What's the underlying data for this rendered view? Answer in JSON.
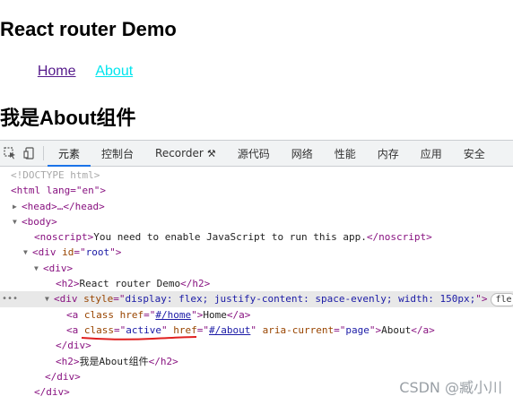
{
  "page": {
    "title": "React router Demo",
    "nav": {
      "home_label": "Home",
      "about_label": "About"
    },
    "component_title": "我是About组件"
  },
  "devtools": {
    "tabs": [
      {
        "label": "元素",
        "selected": true
      },
      {
        "label": "控制台"
      },
      {
        "label": "Recorder",
        "icon": "flask-icon"
      },
      {
        "label": "源代码"
      },
      {
        "label": "网络"
      },
      {
        "label": "性能"
      },
      {
        "label": "内存"
      },
      {
        "label": "应用"
      },
      {
        "label": "安全"
      }
    ],
    "dom": {
      "doctype": "<!DOCTYPE html>",
      "html_open": "<html lang=\"en\">",
      "head": "<head>…</head>",
      "body_open": "<body>",
      "noscript_text": "You need to enable JavaScript to run this app.",
      "root_id": "root",
      "h2_text": "React router Demo",
      "nav_style": "display: flex; justify-content: space-evenly; width: 150px;",
      "badge": "fle",
      "home_href": "#/home",
      "home_text": "Home",
      "about_class": "active",
      "about_href": "#/about",
      "aria_current": "page",
      "about_text": "About",
      "h2_component_text": "我是About组件"
    }
  },
  "watermark": "CSDN @臧小川",
  "colors": {
    "visited_link": "#551a8b",
    "active_link": "#00e5ee",
    "tab_indicator": "#1a73e8",
    "underline_annotation": "#e02020"
  }
}
